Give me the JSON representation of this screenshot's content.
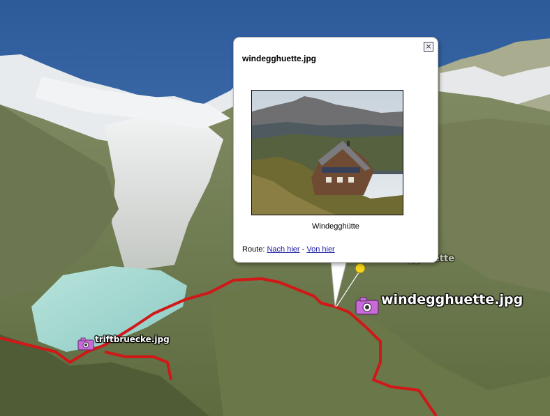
{
  "balloon": {
    "title": "windegghuette.jpg",
    "close_glyph": "×",
    "caption": "Windegghütte",
    "route_label": "Route:",
    "route_to_here": "Nach hier",
    "route_separator": "-",
    "route_from_here": "Von hier"
  },
  "placemarks": {
    "windegg_label": "windegghuette.jpg",
    "triftbruecke_label": "triftbruecke.jpg",
    "ghost_label": "windegghuette"
  },
  "icons": {
    "camera": "camera-icon",
    "pushpin": "yellow-pushpin-icon",
    "close": "close-icon"
  },
  "colors": {
    "route": "#d01818",
    "sky": "#3f6fae",
    "lake": "#a9d8d2",
    "link": "#1a1aa6",
    "camera": "#c86bd8"
  }
}
